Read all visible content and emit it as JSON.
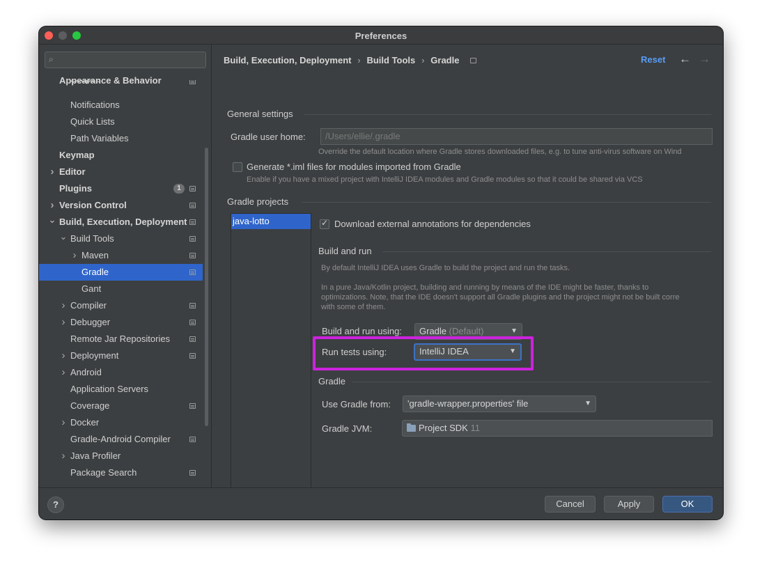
{
  "window": {
    "title": "Preferences"
  },
  "sidebar": {
    "search_placeholder": "",
    "items": [
      {
        "label": "Appearance & Behavior",
        "level": 0,
        "bold": true
      },
      {
        "label": "Scopes",
        "level": 1
      },
      {
        "label": "Notifications",
        "level": 1
      },
      {
        "label": "Quick Lists",
        "level": 1
      },
      {
        "label": "Path Variables",
        "level": 1
      },
      {
        "label": "Keymap",
        "level": 0,
        "bold": true
      },
      {
        "label": "Editor",
        "level": 0,
        "bold": true
      },
      {
        "label": "Plugins",
        "level": 0,
        "bold": true,
        "badge": "1"
      },
      {
        "label": "Version Control",
        "level": 0,
        "bold": true
      },
      {
        "label": "Build, Execution, Deployment",
        "level": 0,
        "bold": true
      },
      {
        "label": "Build Tools",
        "level": 1
      },
      {
        "label": "Maven",
        "level": 2
      },
      {
        "label": "Gradle",
        "level": 2,
        "selected": true
      },
      {
        "label": "Gant",
        "level": 2
      },
      {
        "label": "Compiler",
        "level": 1
      },
      {
        "label": "Debugger",
        "level": 1
      },
      {
        "label": "Remote Jar Repositories",
        "level": 1
      },
      {
        "label": "Deployment",
        "level": 1
      },
      {
        "label": "Android",
        "level": 1
      },
      {
        "label": "Application Servers",
        "level": 1
      },
      {
        "label": "Coverage",
        "level": 1
      },
      {
        "label": "Docker",
        "level": 1
      },
      {
        "label": "Gradle-Android Compiler",
        "level": 1
      },
      {
        "label": "Java Profiler",
        "level": 1
      },
      {
        "label": "Package Search",
        "level": 1
      }
    ]
  },
  "header": {
    "breadcrumb": [
      "Build, Execution, Deployment",
      "Build Tools",
      "Gradle"
    ],
    "reset_label": "Reset"
  },
  "general": {
    "title": "General settings",
    "user_home_label": "Gradle user home:",
    "user_home_value": "/Users/ellie/.gradle",
    "user_home_hint": "Override the default location where Gradle stores downloaded files, e.g. to tune anti-virus software on Wind",
    "iml_label": "Generate *.iml files for modules imported from Gradle",
    "iml_hint": "Enable if you have a mixed project with IntelliJ IDEA modules and Gradle modules so that it could be shared via VCS"
  },
  "projects": {
    "title": "Gradle projects",
    "items": [
      "java-lotto"
    ],
    "download_annotations_label": "Download external annotations for dependencies"
  },
  "build_run": {
    "title": "Build and run",
    "desc1": "By default IntelliJ IDEA uses Gradle to build the project and run the tasks.",
    "desc2": "In a pure Java/Kotlin project, building and running by means of the IDE might be faster, thanks to",
    "desc3": "optimizations. Note, that the IDE doesn't support all Gradle plugins and the project might not be built corre",
    "desc4": "with some of them.",
    "build_using_label": "Build and run using:",
    "build_using_value": "Gradle",
    "build_using_suffix": "(Default)",
    "run_tests_label": "Run tests using:",
    "run_tests_value": "IntelliJ IDEA"
  },
  "gradle": {
    "title": "Gradle",
    "use_from_label": "Use Gradle from:",
    "use_from_value": "'gradle-wrapper.properties' file",
    "jvm_label": "Gradle JVM:",
    "jvm_value": "Project SDK",
    "jvm_version": "11"
  },
  "footer": {
    "help_label": "?",
    "cancel_label": "Cancel",
    "apply_label": "Apply",
    "ok_label": "OK"
  },
  "colors": {
    "selection": "#2f65ca",
    "link": "#589df6",
    "highlight": "#cc22dd",
    "primary_button": "#365880"
  }
}
